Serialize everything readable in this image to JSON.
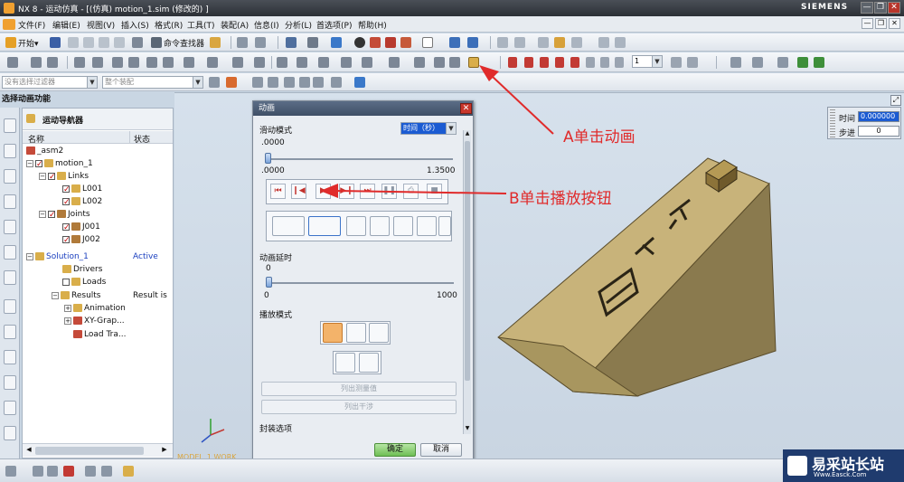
{
  "window": {
    "title": "NX 8 - 运动仿真 - [(仿真) motion_1.sim  (修改的) ]",
    "brand": "SIEMENS",
    "min": "—",
    "restore": "❐",
    "close": "✕"
  },
  "menu": {
    "items": [
      "文件(F)",
      "编辑(E)",
      "视图(V)",
      "插入(S)",
      "格式(R)",
      "工具(T)",
      "装配(A)",
      "信息(I)",
      "分析(L)",
      "首选项(P)",
      "帮助(H)"
    ]
  },
  "toolbar1": {
    "start_label": "开始▾",
    "finder_label": "命令查找器"
  },
  "toolbar2": {
    "frame_value": "1"
  },
  "toolbar3": {
    "filter_placeholder": "没有选择过滤器",
    "assembly_placeholder": "整个装配"
  },
  "section_label": "选择动画功能",
  "navigator": {
    "title": "运动导航器",
    "col_name": "名称",
    "col_status": "状态",
    "rows": [
      {
        "label": "_asm2",
        "status": ""
      },
      {
        "label": "motion_1",
        "status": ""
      },
      {
        "label": "Links",
        "status": ""
      },
      {
        "label": "L001",
        "status": ""
      },
      {
        "label": "L002",
        "status": ""
      },
      {
        "label": "Joints",
        "status": ""
      },
      {
        "label": "J001",
        "status": ""
      },
      {
        "label": "J002",
        "status": ""
      },
      {
        "label": "Solution_1",
        "status": "Active"
      },
      {
        "label": "Drivers",
        "status": ""
      },
      {
        "label": "Loads",
        "status": ""
      },
      {
        "label": "Results",
        "status": "Result is"
      },
      {
        "label": "Animation",
        "status": ""
      },
      {
        "label": "XY-Grap...",
        "status": ""
      },
      {
        "label": "Load Tra...",
        "status": ""
      }
    ]
  },
  "dialog": {
    "title": "动画",
    "slide_mode_label": "滑动模式",
    "slide_mode_value": "时间（秒）",
    "slider_value": ".0000",
    "slider_min": ".0000",
    "slider_max": "1.3500",
    "delay_label": "动画延时",
    "delay_value": "0",
    "delay_min": "0",
    "delay_max": "1000",
    "play_mode_label": "播放模式",
    "list_measure": "列出测量值",
    "list_interference": "列出干涉",
    "package_options": "封装选项",
    "ok": "确定",
    "cancel": "取消"
  },
  "time_panel": {
    "time_label": "时间",
    "time_value": "0.000000",
    "step_label": "步进",
    "step_value": "0"
  },
  "viewport": {
    "ref_label": "MODEL_1 WORK"
  },
  "annotations": {
    "a": "A单击动画",
    "b": "B单击播放按钮"
  },
  "watermark": {
    "cn": "易采站长站",
    "en": "Www.Easck.Com"
  },
  "colors": {
    "annotation": "#e02b2b",
    "ramp_top": "#c8b37a",
    "ramp_side": "#8a7a4e",
    "active_status": "#1a3fbf"
  }
}
